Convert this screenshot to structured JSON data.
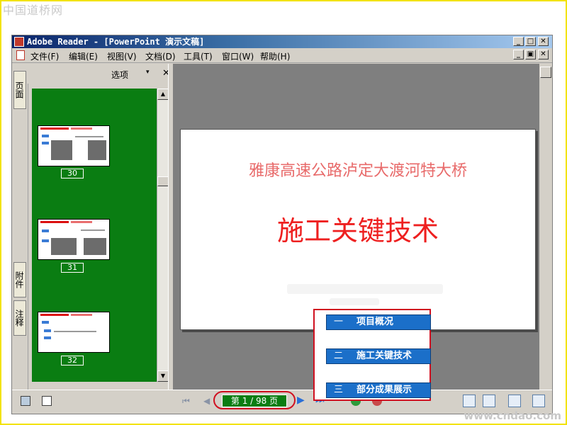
{
  "watermarks": {
    "top": "中国道桥网",
    "bottom": "www.cndao.com"
  },
  "window": {
    "title": "Adobe Reader - [PowerPoint 演示文稿]",
    "buttons": {
      "minimize": "_",
      "maximize": "□",
      "close": "✕",
      "doc_minimize": "_",
      "doc_restore": "▣",
      "doc_close": "✕"
    }
  },
  "menu": {
    "items": [
      {
        "label": "文件(F)"
      },
      {
        "label": "编辑(E)"
      },
      {
        "label": "视图(V)"
      },
      {
        "label": "文档(D)"
      },
      {
        "label": "工具(T)"
      },
      {
        "label": "窗口(W)"
      },
      {
        "label": "帮助(H)"
      }
    ]
  },
  "side_tabs": {
    "pages": "页面",
    "attachments": "附件",
    "comments": "注释"
  },
  "thumbnails_panel": {
    "options_label": "选项",
    "options_caret": "▾",
    "close_label": "✕",
    "thumbnails": [
      {
        "page": "30"
      },
      {
        "page": "31"
      },
      {
        "page": "32"
      }
    ],
    "scroll_up": "▲",
    "scroll_down": "▼"
  },
  "slide": {
    "subtitle": "雅康高速公路泸定大渡河特大桥",
    "title": "施工关键技术"
  },
  "nav_panel": {
    "items": [
      {
        "num": "一",
        "label": "项目概况"
      },
      {
        "num": "二",
        "label": "施工关键技术"
      },
      {
        "num": "三",
        "label": "部分成果展示"
      }
    ]
  },
  "status_bar": {
    "page_display": "第 1 / 98 页",
    "first": "⏮",
    "prev": "◀",
    "next": "▶",
    "last": "⏭"
  },
  "colors": {
    "thumb_bg": "#0a7d12",
    "highlight_red": "#d01020",
    "nav_blue": "#1b6fc9",
    "slide_title_red": "#ee2020",
    "slide_subtitle_red": "#e86a6a"
  }
}
